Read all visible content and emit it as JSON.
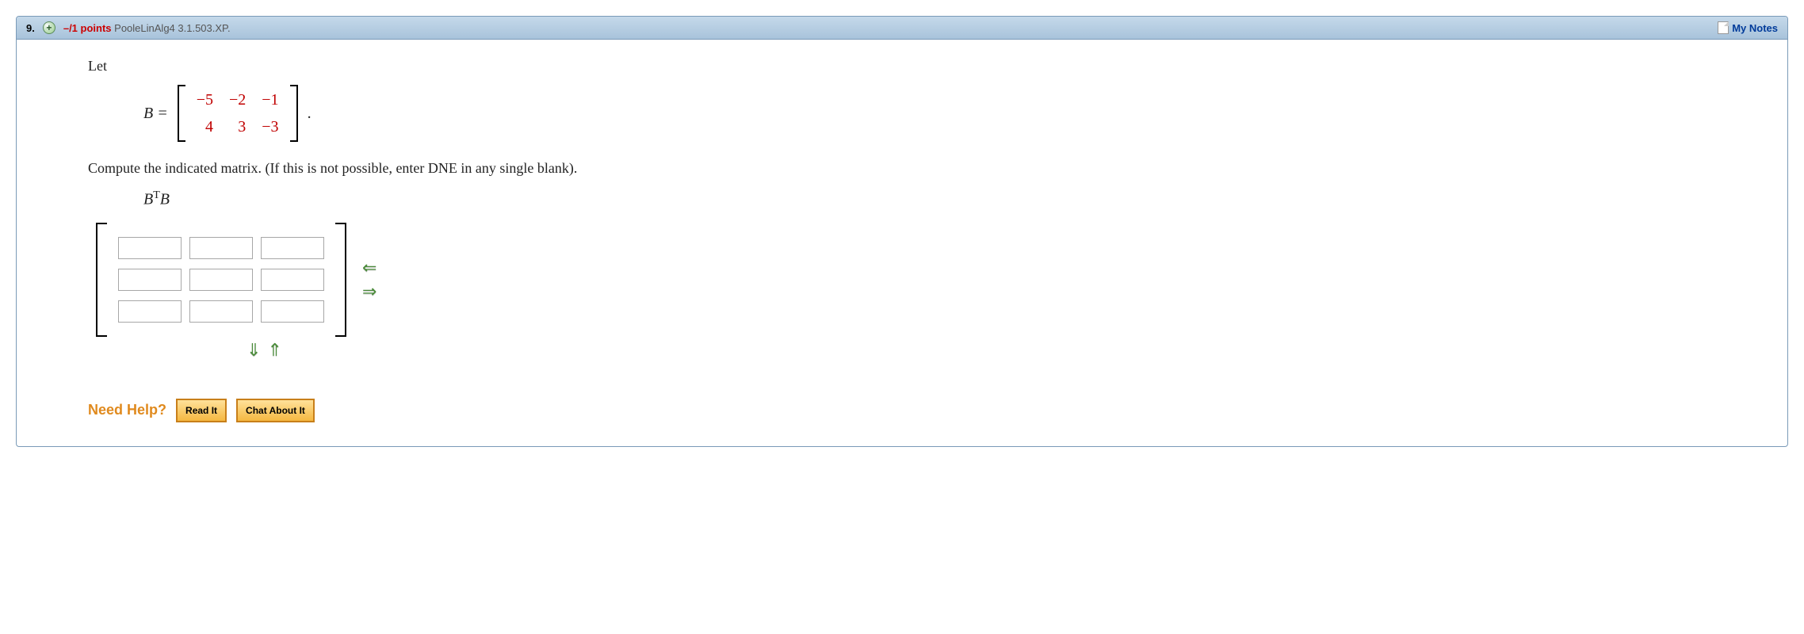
{
  "header": {
    "number": "9.",
    "points": "–/1 points",
    "source": "PooleLinAlg4 3.1.503.XP.",
    "mynotes": "My Notes"
  },
  "problem": {
    "let": "Let",
    "lhs": "B =",
    "matrix": [
      [
        "−5",
        "−2",
        "−1"
      ],
      [
        "4",
        "3",
        "−3"
      ]
    ],
    "period": ".",
    "instruction": "Compute the indicated matrix. (If this is not possible, enter DNE in any single blank).",
    "target_html": "B<sup>T</sup>B",
    "answer_rows": 3,
    "answer_cols": 3
  },
  "help": {
    "label": "Need Help?",
    "read": "Read It",
    "chat": "Chat About It"
  }
}
